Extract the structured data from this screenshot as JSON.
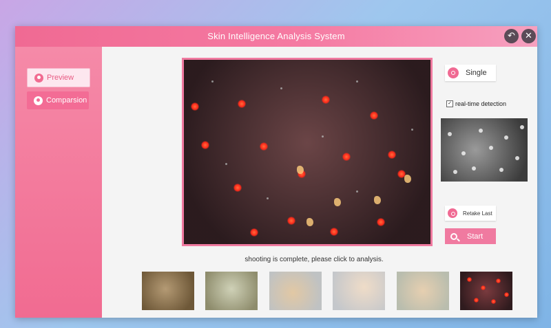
{
  "window": {
    "title": "Skin Intelligence Analysis System",
    "back_icon": "undo-arrow-icon",
    "close_icon": "close-icon"
  },
  "sidebar": {
    "items": [
      {
        "label": "Preview",
        "icon": "leaf-icon"
      },
      {
        "label": "Comparsion",
        "icon": "leaf-icon"
      }
    ]
  },
  "main": {
    "status_text": "shooting is complete, please click to analysis."
  },
  "controls": {
    "single_label": "Single",
    "realtime_label": "real-time detection",
    "realtime_checked": true,
    "retake_label": "Retake Last",
    "start_label": "Start"
  },
  "colors": {
    "accent": "#f06a93",
    "sidebar": "#f16b91",
    "titlebar": "#f57aa2"
  }
}
